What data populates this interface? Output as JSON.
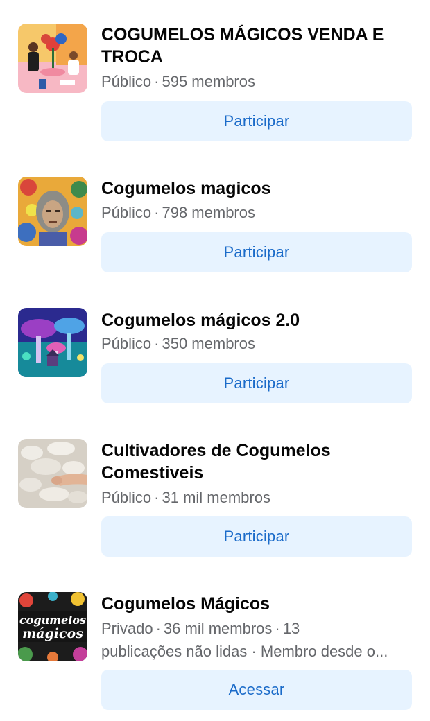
{
  "groups": [
    {
      "name": "COGUMELOS MÁGICOS VENDA E TROCA",
      "privacy": "Público",
      "members": "595 membros",
      "action": "Participar"
    },
    {
      "name": "Cogumelos magicos",
      "privacy": "Público",
      "members": "798 membros",
      "action": "Participar"
    },
    {
      "name": "Cogumelos mágicos 2.0",
      "privacy": "Público",
      "members": "350 membros",
      "action": "Participar"
    },
    {
      "name": "Cultivadores de Cogumelos Comestiveis",
      "privacy": "Público",
      "members": "31 mil membros",
      "action": "Participar"
    },
    {
      "name": "Cogumelos Mágicos",
      "privacy": "Privado",
      "members": "36 mil membros",
      "extra_line1": "13",
      "extra_line2": "publicações não lidas · Membro desde o...",
      "action": "Acessar",
      "thumb_text_1": "cogumelos",
      "thumb_text_2": "mágicos"
    }
  ],
  "separator": "·",
  "colors": {
    "button_bg": "#e7f3ff",
    "button_text": "#1b6bc9",
    "secondary_text": "#65676b",
    "primary_text": "#050505"
  }
}
